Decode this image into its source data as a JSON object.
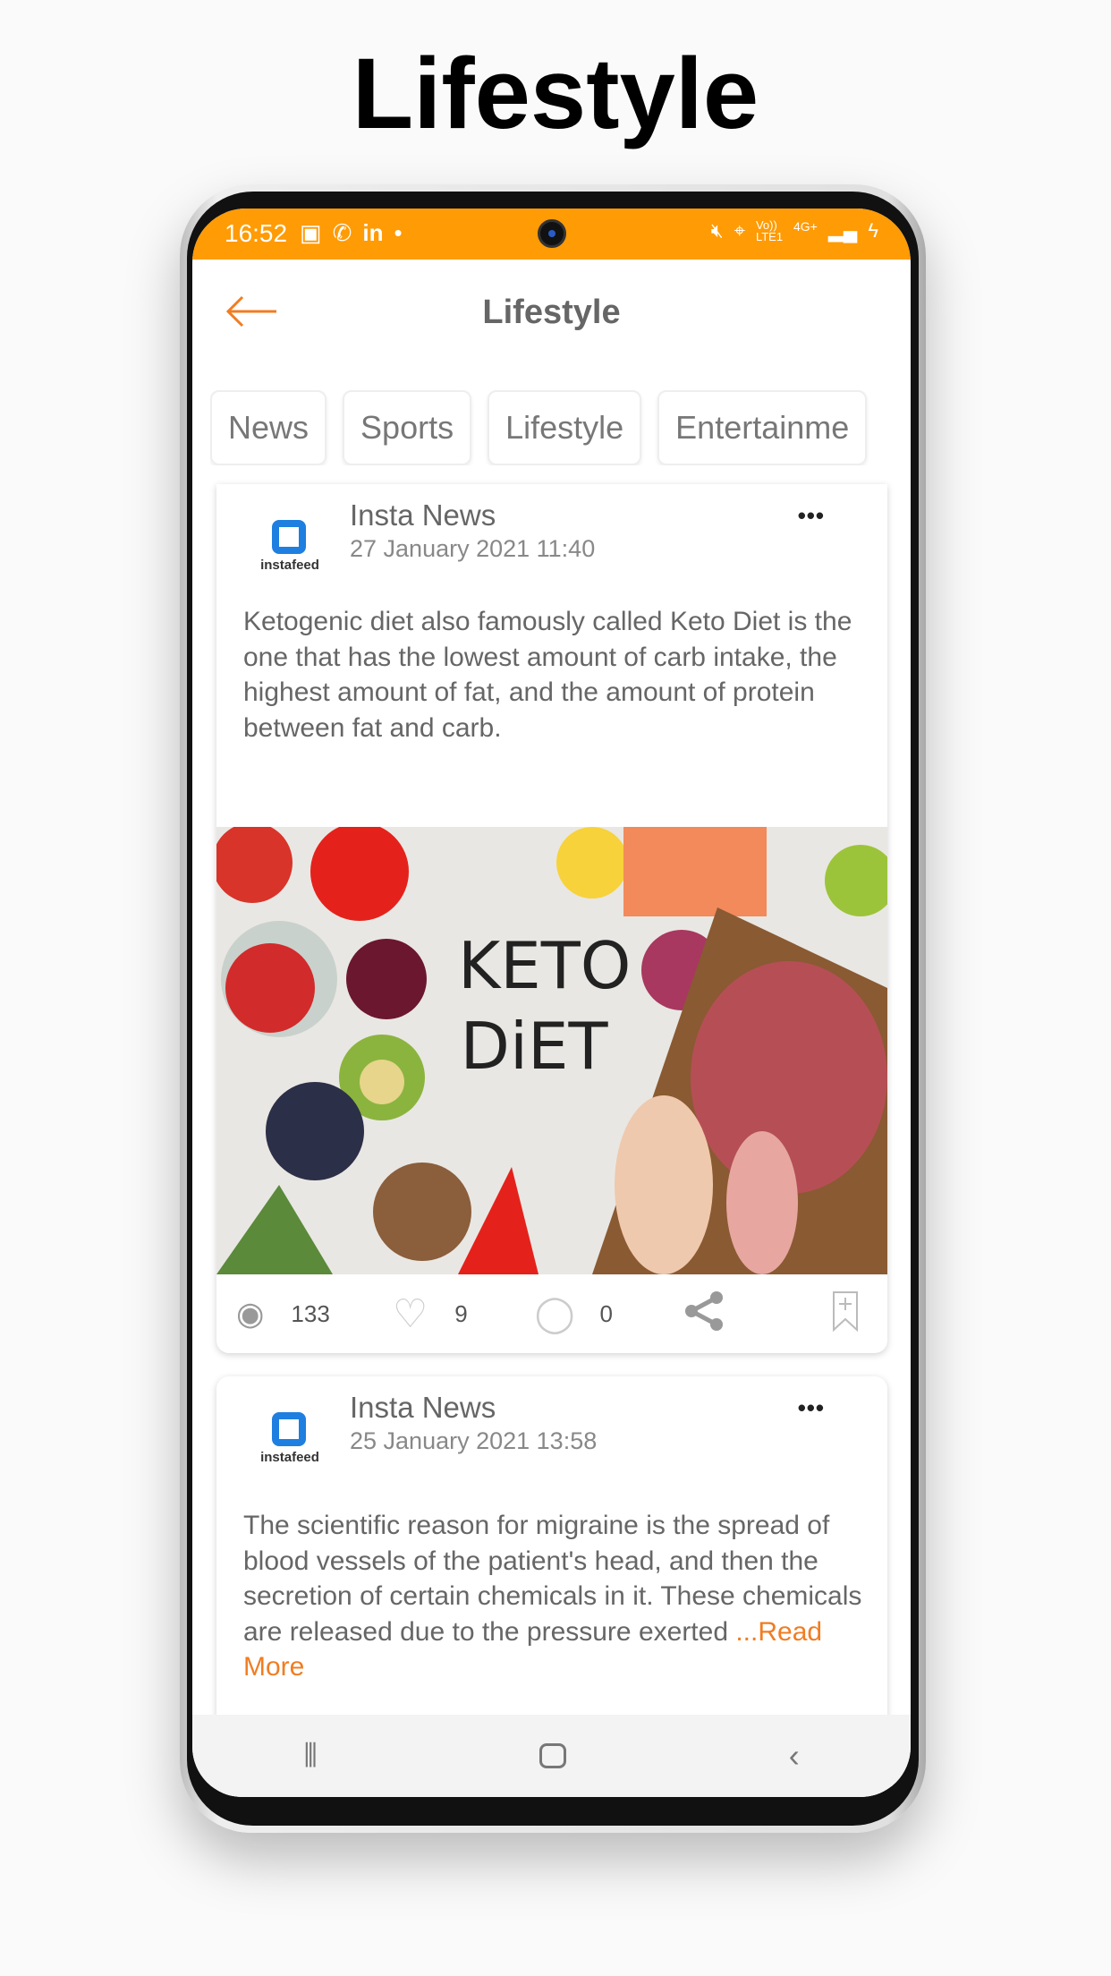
{
  "page_title": "Lifestyle",
  "status_bar": {
    "time": "16:52",
    "left_icons": [
      "gallery-icon",
      "whatsapp-icon",
      "linkedin-icon",
      "dot-icon"
    ],
    "right_icons": [
      "mute-icon",
      "location-icon",
      "volte-icon",
      "signal-icon",
      "battery-charging-icon"
    ],
    "volte": "Vo)) LTE1",
    "network": "4G+"
  },
  "header": {
    "title": "Lifestyle",
    "back_icon": "arrow-left-icon"
  },
  "tabs": [
    {
      "label": "News"
    },
    {
      "label": "Sports"
    },
    {
      "label": "Lifestyle"
    },
    {
      "label": "Entertainme"
    }
  ],
  "posts": [
    {
      "source": "Insta News",
      "avatar_label": "instafeed",
      "date": "27 January 2021 11:40",
      "text": "Ketogenic diet also famously called Keto Diet is the one that has the lowest amount of carb intake, the highest amount of fat, and the amount of protein between fat and carb.",
      "image_text": "KETO DiET",
      "views": "133",
      "likes": "9",
      "comments": "0"
    },
    {
      "source": "Insta News",
      "avatar_label": "instafeed",
      "date": "25 January 2021 13:58",
      "text": "The scientific reason for migraine is the spread of blood vessels of the patient's head, and then the secretion of certain chemicals in it. These chemicals are released due to the pressure exerted ",
      "read_more": "...Read More"
    }
  ],
  "colors": {
    "accent": "#ff9b05",
    "read_more": "#f07d22",
    "brand": "#1e7fe0"
  }
}
